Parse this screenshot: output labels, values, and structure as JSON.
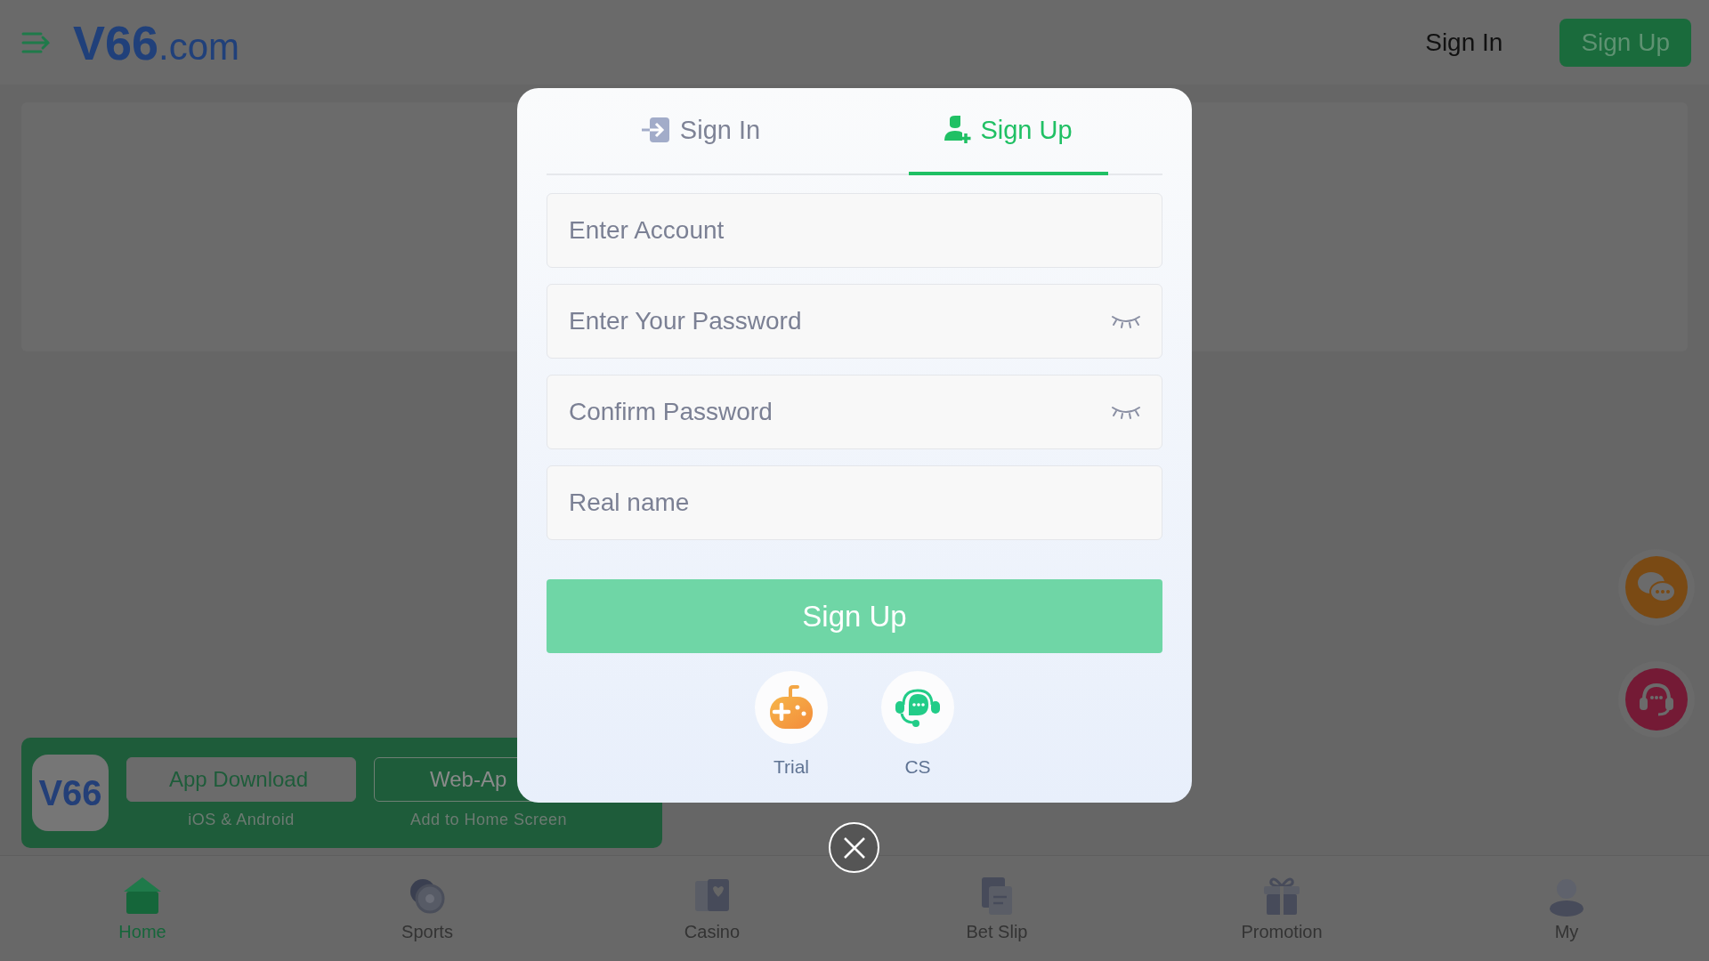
{
  "header": {
    "logo": {
      "main": "V66",
      "suffix": ".com"
    },
    "sign_in": "Sign In",
    "sign_up": "Sign Up"
  },
  "app_banner": {
    "logo": "V66",
    "buttons": [
      {
        "label": "App Download",
        "caption": "iOS & Android",
        "kind": "filled"
      },
      {
        "label": "Web-Ap",
        "caption": "Add to Home Screen",
        "kind": "outline"
      }
    ]
  },
  "modal": {
    "tabs": [
      {
        "label": "Sign In",
        "selected": false,
        "kind": "signin"
      },
      {
        "label": "Sign Up",
        "selected": true,
        "kind": "signup"
      }
    ],
    "fields": [
      {
        "placeholder": "Enter Account",
        "kind": "text"
      },
      {
        "placeholder": "Enter Your Password",
        "kind": "password"
      },
      {
        "placeholder": "Confirm Password",
        "kind": "password"
      },
      {
        "placeholder": "Real name",
        "kind": "text"
      }
    ],
    "submit": "Sign Up",
    "shortcuts": [
      {
        "label": "Trial",
        "kind": "game"
      },
      {
        "label": "CS",
        "kind": "support"
      }
    ]
  },
  "nav": [
    {
      "label": "Home",
      "selected": true,
      "kind": "home"
    },
    {
      "label": "Sports",
      "selected": false,
      "kind": "sports"
    },
    {
      "label": "Casino",
      "selected": false,
      "kind": "casino"
    },
    {
      "label": "Bet Slip",
      "selected": false,
      "kind": "betslip"
    },
    {
      "label": "Promotion",
      "selected": false,
      "kind": "promotion"
    },
    {
      "label": "My",
      "selected": false,
      "kind": "my"
    }
  ]
}
